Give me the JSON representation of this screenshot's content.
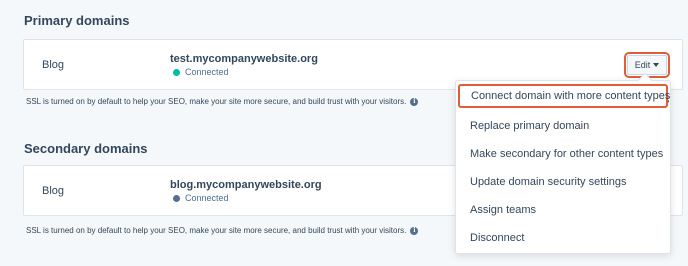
{
  "primary": {
    "title": "Primary domains",
    "card_label": "Blog",
    "domain": "test.mycompanywebsite.org",
    "status": "Connected",
    "status_color": "#00bda5",
    "edit_label": "Edit",
    "ssl_note": "SSL is turned on by default to help your SEO, make your site more secure, and build trust with your visitors."
  },
  "secondary": {
    "title": "Secondary domains",
    "card_label": "Blog",
    "domain": "blog.mycompanywebsite.org",
    "status": "Connected",
    "status_color": "#516f90",
    "ssl_note": "SSL is turned on by default to help your SEO, make your site more secure, and build trust with your visitors."
  },
  "dropdown": {
    "items": [
      "Connect domain with more content types",
      "Replace primary domain",
      "Make secondary for other content types",
      "Update domain security settings",
      "Assign teams",
      "Disconnect"
    ]
  },
  "colors": {
    "highlight": "#e25c3a",
    "connected_primary": "#00bda5",
    "connected_secondary": "#516f90"
  },
  "icons": {
    "info": "info-icon",
    "caret": "caret-down-icon"
  }
}
